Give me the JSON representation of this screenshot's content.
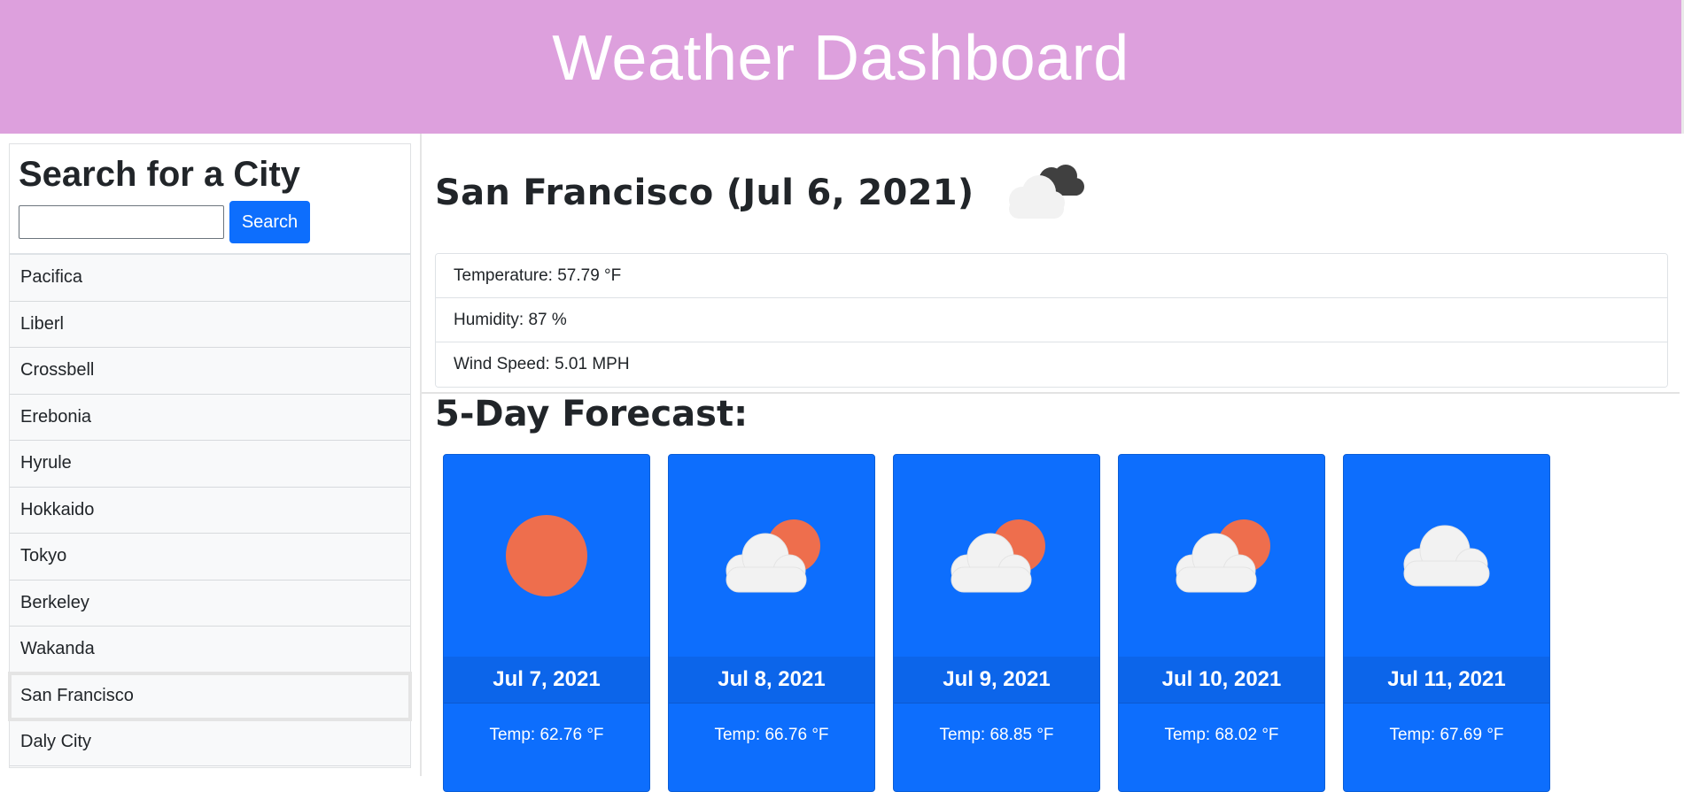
{
  "header": {
    "title": "Weather Dashboard"
  },
  "search": {
    "title": "Search for a City",
    "input_value": "",
    "button_label": "Search"
  },
  "history": [
    {
      "label": "Pacifica"
    },
    {
      "label": "Liberl"
    },
    {
      "label": "Crossbell"
    },
    {
      "label": "Erebonia"
    },
    {
      "label": "Hyrule"
    },
    {
      "label": "Hokkaido"
    },
    {
      "label": "Tokyo"
    },
    {
      "label": "Berkeley"
    },
    {
      "label": "Wakanda"
    },
    {
      "label": "San Francisco"
    },
    {
      "label": "Daly City"
    }
  ],
  "current": {
    "title": "San Francisco (Jul 6, 2021)",
    "icon": "broken-clouds-icon",
    "temperature": "Temperature: 57.79 °F",
    "humidity": "Humidity: 87 %",
    "wind": "Wind Speed: 5.01 MPH"
  },
  "forecast": {
    "title": "5-Day Forecast:",
    "days": [
      {
        "date": "Jul 7, 2021",
        "temp": "Temp: 62.76 °F",
        "icon": "sun-icon"
      },
      {
        "date": "Jul 8, 2021",
        "temp": "Temp: 66.76 °F",
        "icon": "partly-cloudy-icon"
      },
      {
        "date": "Jul 9, 2021",
        "temp": "Temp: 68.85 °F",
        "icon": "partly-cloudy-icon"
      },
      {
        "date": "Jul 10, 2021",
        "temp": "Temp: 68.02 °F",
        "icon": "partly-cloudy-icon"
      },
      {
        "date": "Jul 11, 2021",
        "temp": "Temp: 67.69 °F",
        "icon": "cloud-icon"
      }
    ]
  },
  "colors": {
    "header_bg": "#dda0dd",
    "primary": "#0d6efd",
    "sun": "#ee6e4d",
    "cloud": "#f2f2f2"
  }
}
